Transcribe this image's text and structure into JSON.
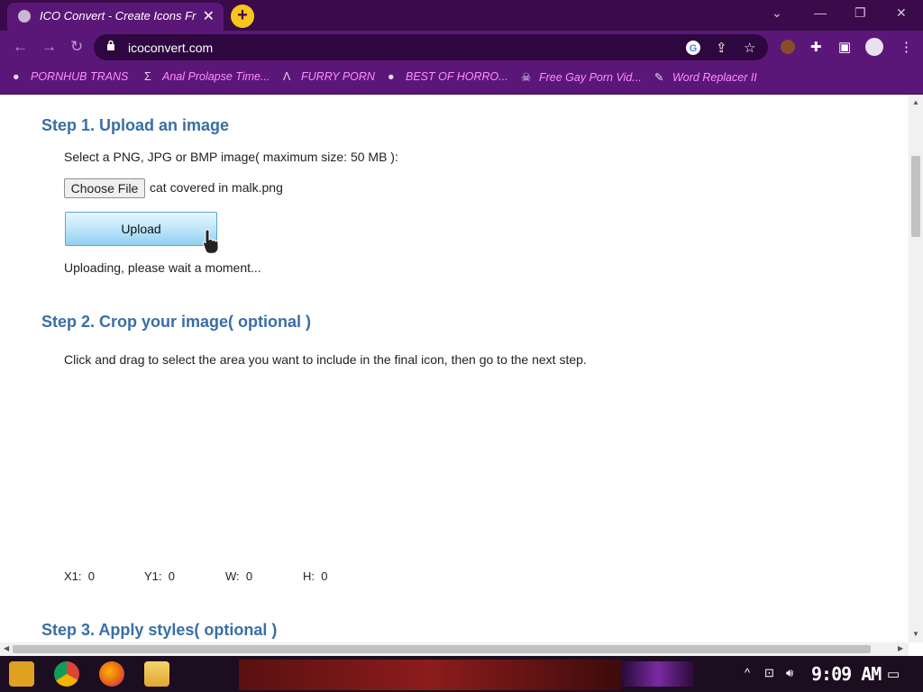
{
  "browser": {
    "tab_title": "ICO Convert - Create Icons Fr",
    "tab_close": "✕",
    "new_tab": "+",
    "url": "icoconvert.com",
    "window_controls": {
      "minimize": "—",
      "restore": "❐",
      "close": "✕",
      "dropdown": "⌄"
    }
  },
  "bookmarks": [
    {
      "label": "PORNHUB TRANS",
      "icon": "globe-icon"
    },
    {
      "label": "Anal Prolapse Time...",
      "icon": "sigma-icon"
    },
    {
      "label": "FURRY PORN",
      "icon": "lambda-icon"
    },
    {
      "label": "BEST OF HORRO...",
      "icon": "globe-icon"
    },
    {
      "label": "Free Gay Porn Vid...",
      "icon": "skull-icon"
    },
    {
      "label": "Word Replacer II",
      "icon": "wr-icon"
    }
  ],
  "page": {
    "step1": {
      "heading": "Step 1. Upload an image",
      "instruction": "Select a PNG, JPG or BMP image( maximum size: 50 MB ):",
      "choose_file": "Choose File",
      "filename": "cat covered in malk.png",
      "upload_button": "Upload",
      "status": "Uploading, please wait a moment..."
    },
    "step2": {
      "heading": "Step 2. Crop your image( optional )",
      "instruction": "Click and drag to select the area you want to include in the final icon, then go to the next step.",
      "coords": [
        {
          "label": "X1:",
          "value": "0"
        },
        {
          "label": "Y1:",
          "value": "0"
        },
        {
          "label": "W:",
          "value": "0"
        },
        {
          "label": "H:",
          "value": "0"
        }
      ]
    },
    "step3": {
      "heading": "Step 3. Apply styles( optional )"
    }
  },
  "taskbar": {
    "time": "9:09 AM"
  },
  "colors": {
    "chrome": "#5b1778",
    "tabstrip": "#3a0a4a",
    "heading": "#3a6ea5",
    "bookmark": "#ff8cff",
    "upload": "#bfe6fa"
  }
}
